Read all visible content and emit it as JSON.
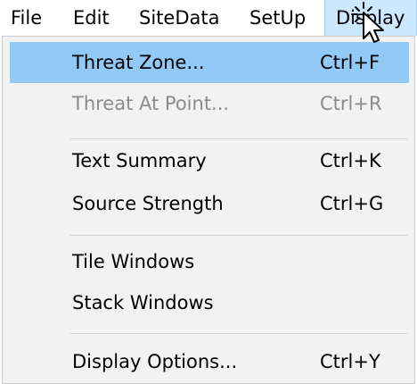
{
  "menubar": {
    "items": [
      {
        "label": "File"
      },
      {
        "label": "Edit"
      },
      {
        "label": "SiteData"
      },
      {
        "label": "SetUp"
      },
      {
        "label": "Display",
        "active": true
      }
    ]
  },
  "dropdown": {
    "items": [
      {
        "label": "Threat Zone...",
        "shortcut": "Ctrl+F",
        "state": "highlighted"
      },
      {
        "label": "Threat At Point...",
        "shortcut": "Ctrl+R",
        "state": "disabled"
      },
      {
        "label": "Text Summary",
        "shortcut": "Ctrl+K",
        "state": "normal"
      },
      {
        "label": "Source Strength",
        "shortcut": "Ctrl+G",
        "state": "normal"
      },
      {
        "label": "Tile Windows",
        "shortcut": "",
        "state": "normal"
      },
      {
        "label": "Stack Windows",
        "shortcut": "",
        "state": "normal"
      },
      {
        "label": "Display Options...",
        "shortcut": "Ctrl+Y",
        "state": "normal"
      }
    ]
  },
  "colors": {
    "highlight": "#91c9f7",
    "active_menu": "#cce8ff",
    "disabled_text": "#8b8b8b",
    "menu_background": "#f2f2f2"
  },
  "icons": {
    "cursor": "pointer-arrow-cursor-with-click-sparkle"
  }
}
